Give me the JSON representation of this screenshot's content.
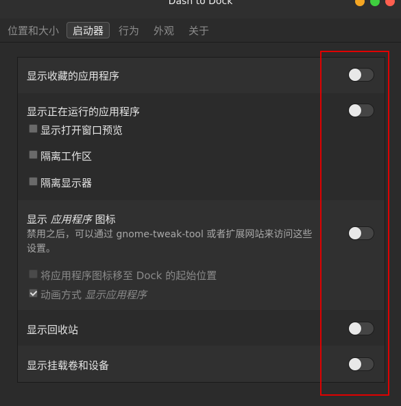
{
  "window": {
    "title": "Dash to Dock"
  },
  "tabs": [
    {
      "label": "位置和大小"
    },
    {
      "label": "启动器"
    },
    {
      "label": "行为"
    },
    {
      "label": "外观"
    },
    {
      "label": "关于"
    }
  ],
  "active_tab": "启动器",
  "settings": {
    "show_favorites": {
      "label": "显示收藏的应用程序"
    },
    "show_running": {
      "label": "显示正在运行的应用程序",
      "options": [
        {
          "label": "显示打开窗口预览"
        },
        {
          "label": "隔离工作区"
        },
        {
          "label": "隔离显示器"
        }
      ]
    },
    "show_apps_icon": {
      "label_prefix": "显示 ",
      "label_italic": "应用程序",
      "label_suffix": " 图标",
      "description": "禁用之后，可以通过 gnome-tweak-tool 或者扩展网站来访问这些设置。",
      "options": [
        {
          "label": "将应用程序图标移至 Dock 的起始位置"
        },
        {
          "label_prefix": "动画方式 ",
          "label_italic": "显示应用程序"
        }
      ]
    },
    "show_trash": {
      "label": "显示回收站"
    },
    "show_mounts": {
      "label": "显示挂载卷和设备"
    }
  },
  "colors": {
    "highlight": "#e00000"
  }
}
